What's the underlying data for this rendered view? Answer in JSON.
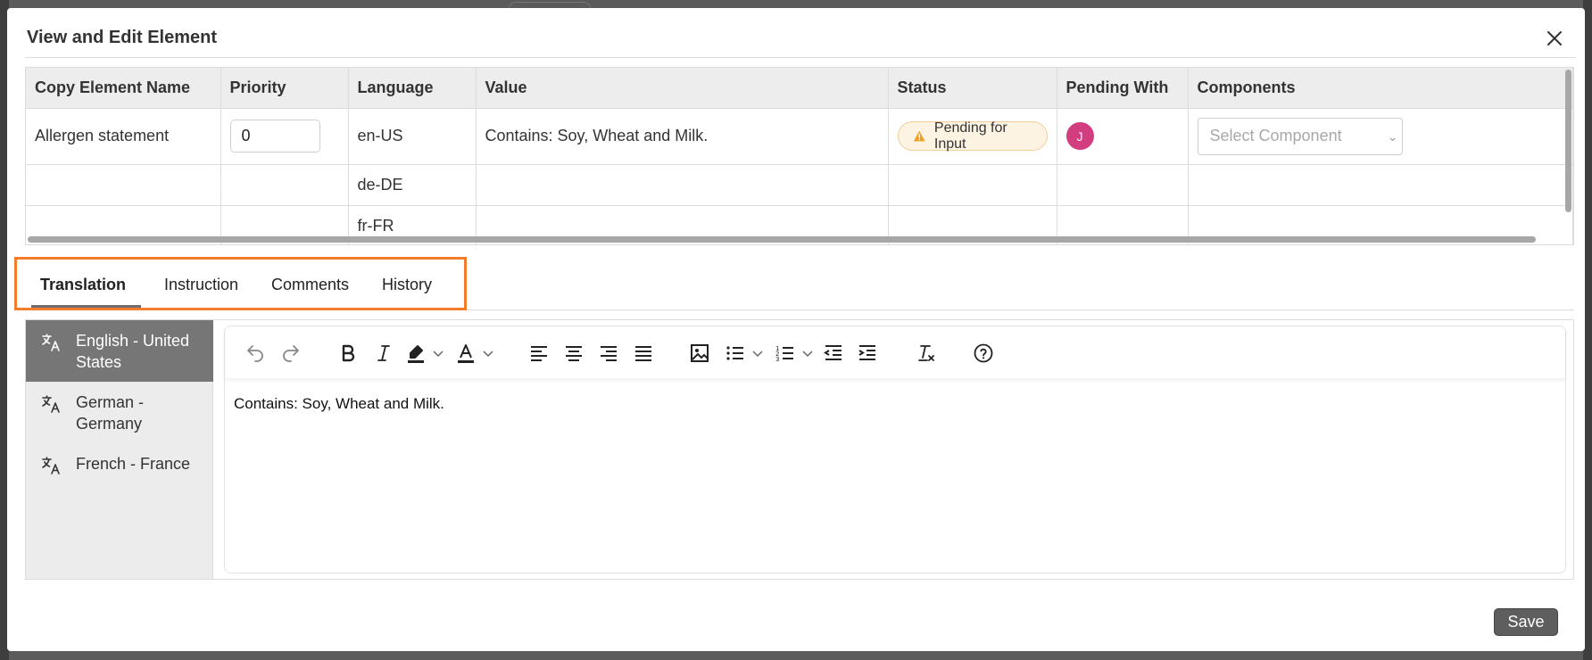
{
  "modal": {
    "title": "View and Edit Element",
    "save_label": "Save"
  },
  "table": {
    "headers": [
      "Copy Element Name",
      "Priority",
      "Language",
      "Value",
      "Status",
      "Pending With",
      "Components"
    ],
    "rows": [
      {
        "name": "Allergen statement",
        "priority": "0",
        "language": "en-US",
        "value": "Contains: Soy, Wheat and Milk.",
        "status": "Pending for Input",
        "pending_with_initial": "J",
        "components_placeholder": "Select Component"
      },
      {
        "language": "de-DE"
      },
      {
        "language": "fr-FR"
      }
    ]
  },
  "tabs": [
    "Translation",
    "Instruction",
    "Comments",
    "History"
  ],
  "active_tab": "Translation",
  "languages": [
    {
      "label": "English - United States",
      "active": true,
      "icon": "translate-icon"
    },
    {
      "label": "German - Germany",
      "active": false,
      "icon": "translate-icon"
    },
    {
      "label": "French - France",
      "active": false,
      "icon": "translate-icon"
    }
  ],
  "editor": {
    "content": "Contains: Soy, Wheat and Milk.",
    "toolbar": [
      "undo-icon",
      "redo-icon",
      "bold-icon",
      "italic-icon",
      "highlight-icon",
      "font-color-icon",
      "align-left-icon",
      "align-center-icon",
      "align-right-icon",
      "align-justify-icon",
      "image-icon",
      "bullet-list-icon",
      "numbered-list-icon",
      "outdent-icon",
      "indent-icon",
      "clear-format-icon",
      "help-icon"
    ]
  },
  "colors": {
    "tab_highlight": "#f47c2b",
    "status_warning": "#f0a020",
    "avatar": "#d23d7f"
  }
}
